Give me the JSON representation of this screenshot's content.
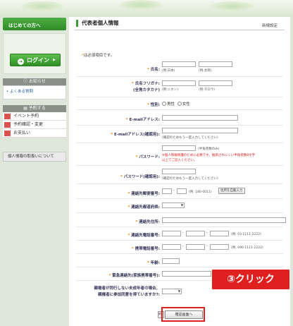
{
  "sidebar": {
    "first_time": "はじめての方へ",
    "login": "ログイン",
    "news_head": "お知らせ",
    "faq": "• よくある質問",
    "reserve_head": "予約する",
    "items": [
      "イベント予約",
      "予約確認・変更",
      "お支払い"
    ],
    "privacy": "個人情報の取扱いについて"
  },
  "main": {
    "title": "代表者個人情報",
    "right": "新規設定",
    "required_note": "は必須項目です。",
    "fields": {
      "name": "氏名:",
      "name_hint": "(例:日本)",
      "name_hint2": "(例:太郎)",
      "kana1": "氏名フリガナ:",
      "kana2": "(全角カタカナ)",
      "kana_hint": "(例:ニホン)",
      "kana_hint2": "(例:タロウ)",
      "gender": "性別:",
      "male": "男性",
      "female": "女性",
      "email": "E-mailアドレス:",
      "email2": "E-mailアドレス(確認用):",
      "email2_hint": "(確認のためもう一度入力してください)",
      "password": "パスワード:",
      "pw_hint1": "(半角英数のみ)",
      "pw_hint2": "※個人情報保護のために必要です。推測されにくい半角英数8文字",
      "pw_hint3": "以上でご記入ください。",
      "password2": "パスワード(確認用):",
      "pw2_hint": "(確認のためもう一度入力してください)",
      "zip": "連絡先郵便番号:",
      "zip_hint": "(例: 180-0011)",
      "zip_btn": "住所を自動入力",
      "pref": "連絡先都道府県:",
      "addr": "連絡先住所:",
      "tel": "連絡先電話番号:",
      "tel_hint": "(例: 03-1111-2222)",
      "mobile": "携帯電話番号:",
      "mobile_hint": "(例: 090-1111-2222)",
      "age": "年齢:",
      "emergency": "緊急連絡先(家族携帯番号):",
      "minor1": "親権者が同行しない未成年者の場合、",
      "minor2": "親権者に参加同意を得ていますか?:",
      "back": "戻",
      "confirm": "確認画面へ"
    },
    "callout": "③クリック"
  }
}
